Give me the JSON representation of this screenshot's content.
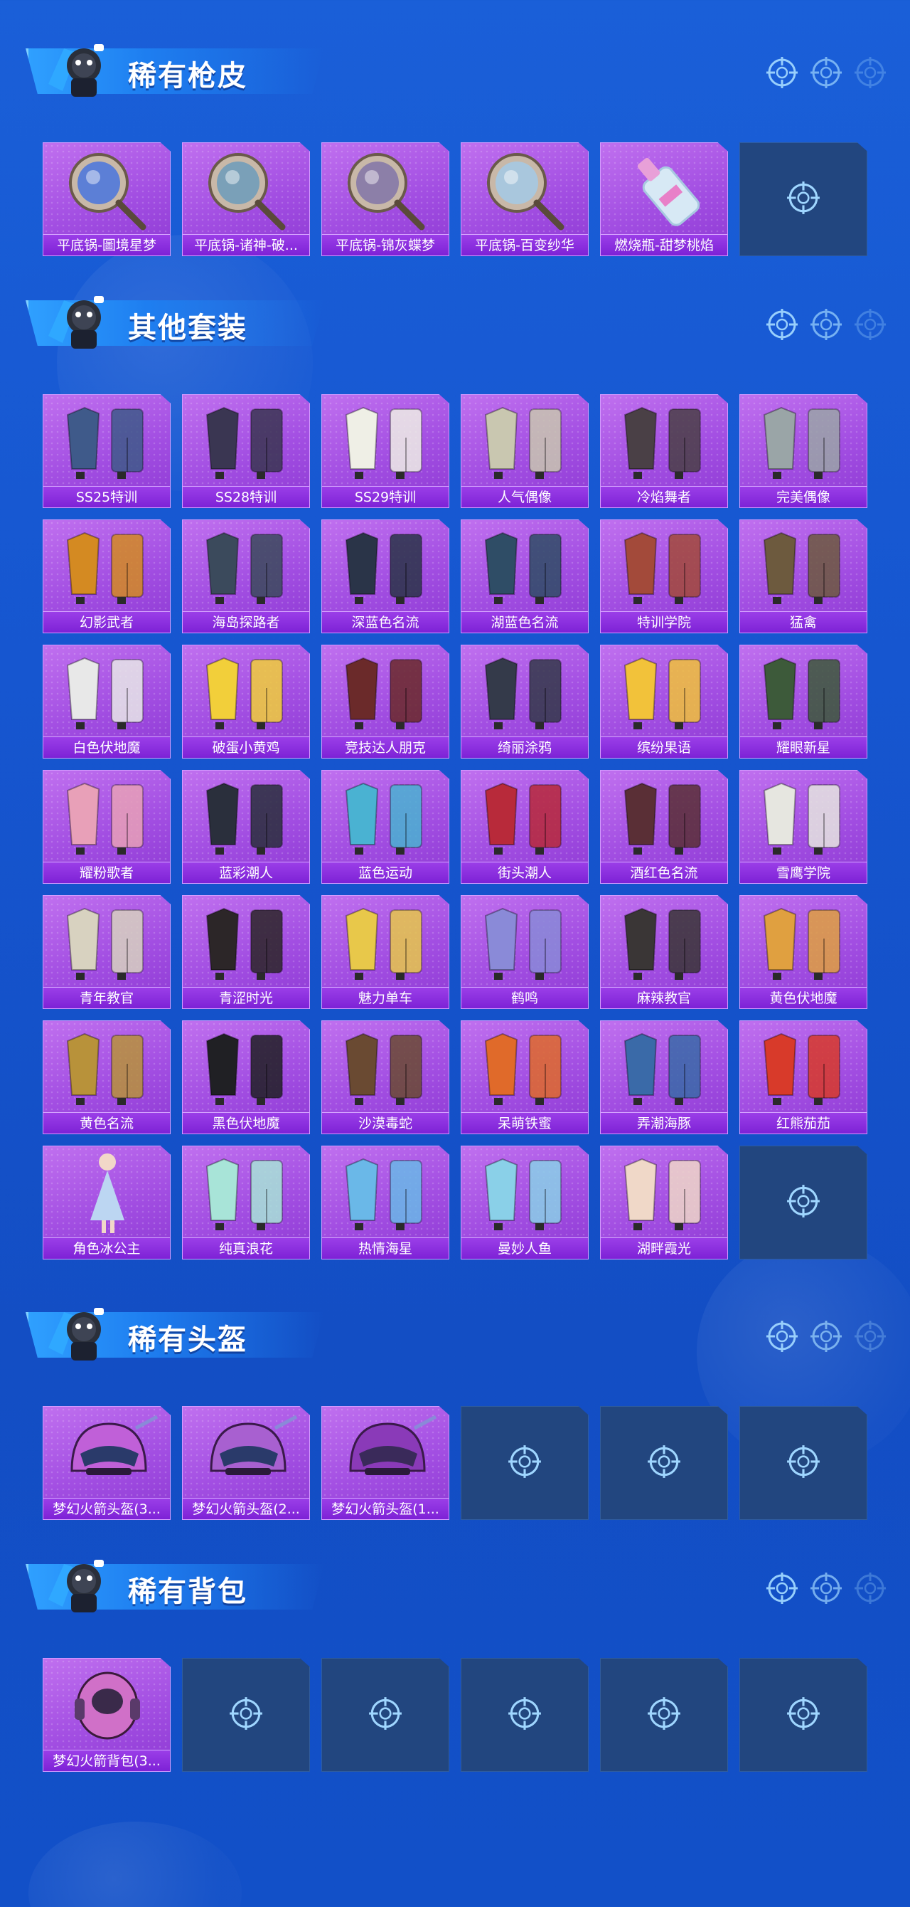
{
  "sections": [
    {
      "title": "稀有枪皮",
      "items": [
        {
          "label": "平底锅-圖境星梦",
          "art": "pan",
          "accent": "#5c7fd6"
        },
        {
          "label": "平底锅-诸神-破...",
          "art": "pan",
          "accent": "#7aa0b8"
        },
        {
          "label": "平底锅-锦灰蝶梦",
          "art": "pan",
          "accent": "#8c7fa8"
        },
        {
          "label": "平底锅-百变纱华",
          "art": "pan",
          "accent": "#a9c7dd"
        },
        {
          "label": "燃烧瓶-甜梦桃焰",
          "art": "bottle",
          "accent": "#d7e9f5"
        },
        {
          "empty": true
        }
      ]
    },
    {
      "title": "其他套装",
      "items": [
        {
          "label": "SS25特训",
          "art": "outfit",
          "accent": "#3f5a8a"
        },
        {
          "label": "SS28特训",
          "art": "outfit",
          "accent": "#3a3652"
        },
        {
          "label": "SS29特训",
          "art": "outfit",
          "accent": "#efefe6"
        },
        {
          "label": "人气偶像",
          "art": "outfit",
          "accent": "#c9c7b0"
        },
        {
          "label": "冷焰舞者",
          "art": "outfit",
          "accent": "#4a4046"
        },
        {
          "label": "完美偶像",
          "art": "outfit",
          "accent": "#9aa5a7"
        },
        {
          "label": "幻影武者",
          "art": "outfit",
          "accent": "#d48a22"
        },
        {
          "label": "海岛探路者",
          "art": "outfit",
          "accent": "#3b4a5c"
        },
        {
          "label": "深蓝色名流",
          "art": "outfit",
          "accent": "#2a3448"
        },
        {
          "label": "湖蓝色名流",
          "art": "outfit",
          "accent": "#2f4d66"
        },
        {
          "label": "特训学院",
          "art": "outfit",
          "accent": "#a34a3a"
        },
        {
          "label": "猛禽",
          "art": "outfit",
          "accent": "#6d5a3e"
        },
        {
          "label": "白色伏地魔",
          "art": "outfit",
          "accent": "#e8e8e8"
        },
        {
          "label": "破蛋小黄鸡",
          "art": "outfit",
          "accent": "#f2cf3a"
        },
        {
          "label": "竞技达人朋克",
          "art": "outfit",
          "accent": "#6b2a2a"
        },
        {
          "label": "绮丽涂鸦",
          "art": "outfit",
          "accent": "#343a4a"
        },
        {
          "label": "缤纷果语",
          "art": "outfit",
          "accent": "#f2c23a"
        },
        {
          "label": "耀眼新星",
          "art": "outfit",
          "accent": "#3d5a3a"
        },
        {
          "label": "耀粉歌者",
          "art": "outfit",
          "accent": "#e8a0b8"
        },
        {
          "label": "蓝彩潮人",
          "art": "outfit",
          "accent": "#2a2f3c"
        },
        {
          "label": "蓝色运动",
          "art": "outfit",
          "accent": "#4ab2d2"
        },
        {
          "label": "街头潮人",
          "art": "outfit",
          "accent": "#b82a3a"
        },
        {
          "label": "酒红色名流",
          "art": "outfit",
          "accent": "#5a2f36"
        },
        {
          "label": "雪鹰学院",
          "art": "outfit",
          "accent": "#e6e6e0"
        },
        {
          "label": "青年教官",
          "art": "outfit",
          "accent": "#d8d2c0"
        },
        {
          "label": "青涩时光",
          "art": "outfit",
          "accent": "#2c2628"
        },
        {
          "label": "魅力单车",
          "art": "outfit",
          "accent": "#e8c84a"
        },
        {
          "label": "鹤鸣",
          "art": "outfit",
          "accent": "#8a8ad8"
        },
        {
          "label": "麻辣教官",
          "art": "outfit",
          "accent": "#3a3636"
        },
        {
          "label": "黄色伏地魔",
          "art": "outfit",
          "accent": "#e0a040"
        },
        {
          "label": "黄色名流",
          "art": "outfit",
          "accent": "#b8923a"
        },
        {
          "label": "黑色伏地魔",
          "art": "outfit",
          "accent": "#202024"
        },
        {
          "label": "沙漠毒蛇",
          "art": "outfit",
          "accent": "#6a4a32"
        },
        {
          "label": "呆萌铁蜜",
          "art": "outfit",
          "accent": "#e06a2a"
        },
        {
          "label": "弄潮海豚",
          "art": "outfit",
          "accent": "#3a6aa8"
        },
        {
          "label": "红熊茄茄",
          "art": "outfit",
          "accent": "#d83a2a"
        },
        {
          "label": "角色冰公主",
          "art": "figure",
          "accent": "#bcd6f2"
        },
        {
          "label": "纯真浪花",
          "art": "outfit",
          "accent": "#a8e4d8"
        },
        {
          "label": "热情海星",
          "art": "outfit",
          "accent": "#6ab8e8"
        },
        {
          "label": "曼妙人鱼",
          "art": "outfit",
          "accent": "#8ad0e8"
        },
        {
          "label": "湖畔霞光",
          "art": "outfit",
          "accent": "#f0d8c8"
        },
        {
          "empty": true
        }
      ]
    },
    {
      "title": "稀有头盔",
      "items": [
        {
          "label": "梦幻火箭头盔(3...",
          "art": "helmet",
          "accent": "#c060d8"
        },
        {
          "label": "梦幻火箭头盔(2...",
          "art": "helmet",
          "accent": "#a860d0"
        },
        {
          "label": "梦幻火箭头盔(1...",
          "art": "helmet1",
          "accent": "#8a3ab8"
        },
        {
          "empty": true
        },
        {
          "empty": true
        },
        {
          "empty": true
        }
      ]
    },
    {
      "title": "稀有背包",
      "items": [
        {
          "label": "梦幻火箭背包(3...",
          "art": "backpack",
          "accent": "#d070c8"
        },
        {
          "empty": true
        },
        {
          "empty": true
        },
        {
          "empty": true
        },
        {
          "empty": true
        },
        {
          "empty": true
        }
      ]
    }
  ]
}
